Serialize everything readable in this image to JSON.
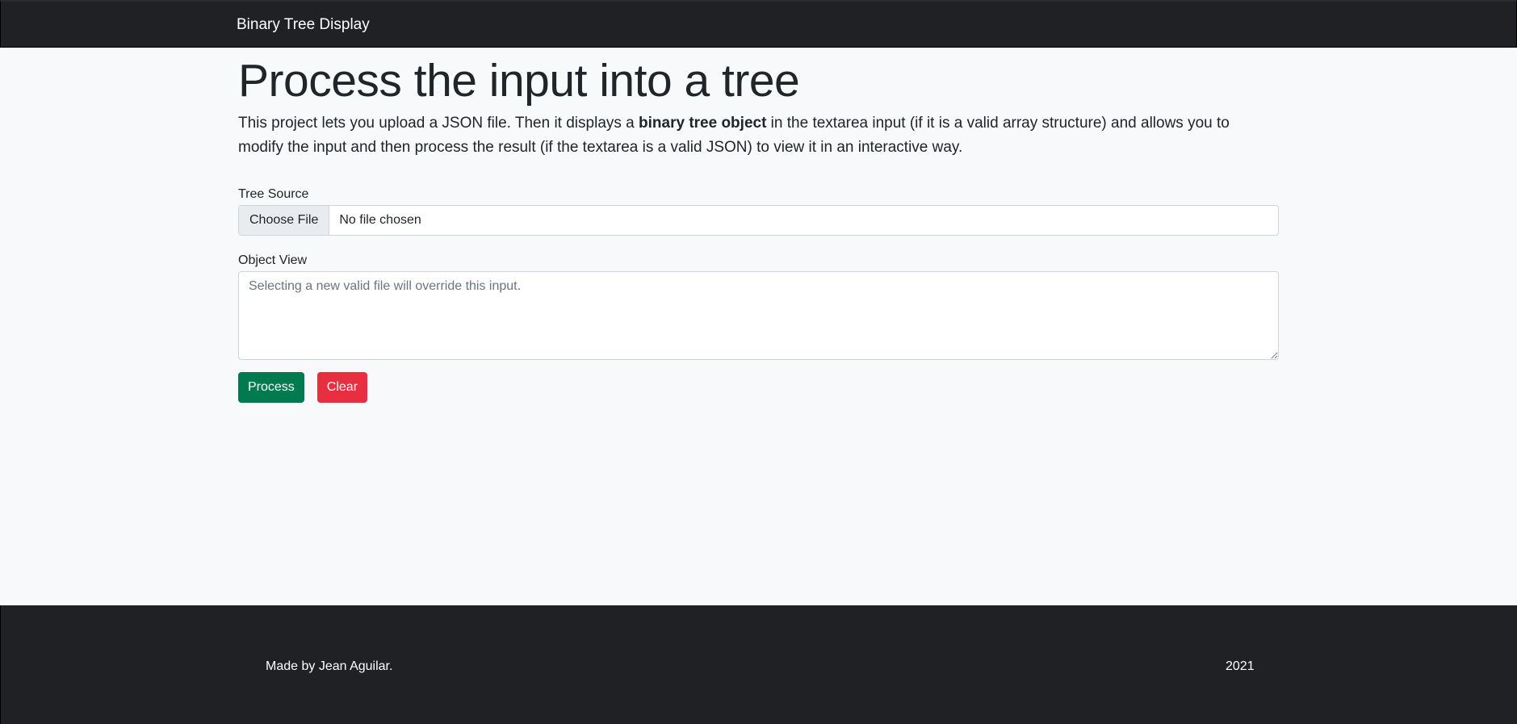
{
  "navbar": {
    "brand": "Binary Tree Display"
  },
  "main": {
    "title": "Process the input into a tree",
    "description": {
      "before": "This project lets you upload a JSON file. Then it displays a ",
      "bold": "binary tree object",
      "after": " in the textarea input (if it is a valid array structure) and allows you to modify the input and then process the result (if the textarea is a valid JSON) to view it in an interactive way."
    },
    "tree_source": {
      "label": "Tree Source",
      "button": "Choose File",
      "value": "No file chosen"
    },
    "object_view": {
      "label": "Object View",
      "placeholder": "Selecting a new valid file will override this input.",
      "value": ""
    },
    "buttons": {
      "process": "Process",
      "clear": "Clear"
    }
  },
  "footer": {
    "credit": "Made by Jean Aguilar.",
    "year": "2021"
  },
  "colors": {
    "navbar": "#1f2124",
    "process": "#017a4f",
    "clear": "#e72f40"
  }
}
